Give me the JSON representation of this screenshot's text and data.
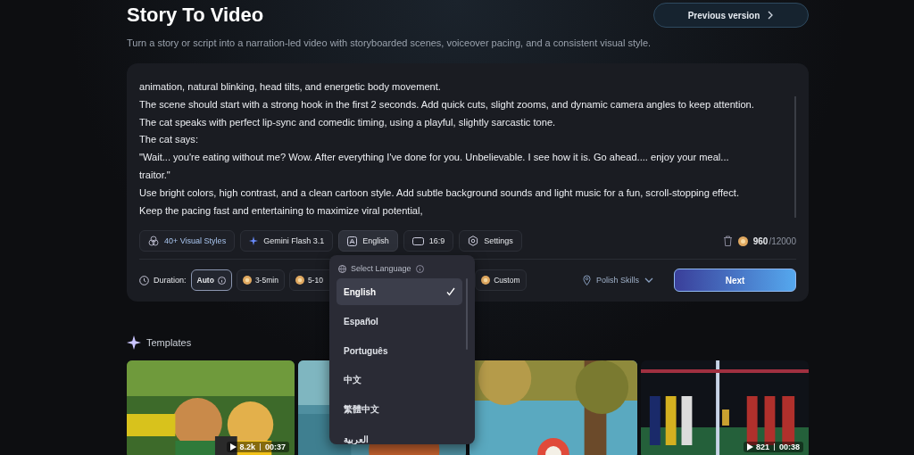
{
  "header": {
    "title": "Story To Video",
    "subtitle": "Turn a story or script into a narration-led video with storyboarded scenes, voiceover pacing, and a consistent visual style.",
    "previous_button": "Previous version"
  },
  "prompt": {
    "lines": [
      "animation, natural blinking, head tilts, and energetic body movement.",
      "The scene should start with a strong hook in the first 2 seconds. Add quick cuts, slight zooms, and dynamic camera angles to keep attention.",
      "The cat speaks with perfect lip-sync and comedic timing, using a playful, slightly sarcastic tone.",
      "The cat says:",
      "\"Wait... you're eating without me? Wow. After everything I've done for you. Unbelievable. I see how it is. Go ahead.... enjoy your meal...",
      "traitor.\"",
      "Use bright colors, high contrast, and a clean cartoon style. Add subtle background sounds and light music for a fun, scroll-stopping effect.",
      "Keep the pacing fast and entertaining to maximize viral potential,"
    ]
  },
  "options": [
    {
      "kind": "styles",
      "label": "40+ Visual Styles",
      "selected": false
    },
    {
      "kind": "model",
      "label": "Gemini Flash 3.1",
      "selected": false
    },
    {
      "kind": "language",
      "label": "English",
      "selected": true
    },
    {
      "kind": "ratio",
      "label": "16:9",
      "selected": false
    },
    {
      "kind": "settings",
      "label": "Settings",
      "selected": false
    }
  ],
  "credits": {
    "used": "960",
    "total": "/12000"
  },
  "duration": {
    "label": "Duration:",
    "choices": [
      {
        "label": "Auto",
        "selected": true,
        "info": true
      },
      {
        "label": "3-5min",
        "selected": false,
        "info": false
      },
      {
        "label": "5-10",
        "selected": false,
        "info": false
      },
      {
        "label": "Custom",
        "selected": false,
        "info": false
      }
    ]
  },
  "polish": "Polish Skills",
  "next_button": "Next",
  "language_menu": {
    "title": "Select Language",
    "items": [
      {
        "label": "English",
        "selected": true
      },
      {
        "label": "Español",
        "selected": false
      },
      {
        "label": "Português",
        "selected": false
      },
      {
        "label": "中文",
        "selected": false
      },
      {
        "label": "繁體中文",
        "selected": false
      },
      {
        "label": "العربية",
        "selected": false
      }
    ]
  },
  "templates": {
    "title": "Templates",
    "cards": [
      {
        "kind": "picture",
        "views": "8.2k",
        "length": "00:37"
      },
      {
        "kind": "picture"
      },
      {
        "kind": "picture"
      },
      {
        "kind": "picture",
        "views": "821",
        "length": "00:38"
      }
    ]
  }
}
